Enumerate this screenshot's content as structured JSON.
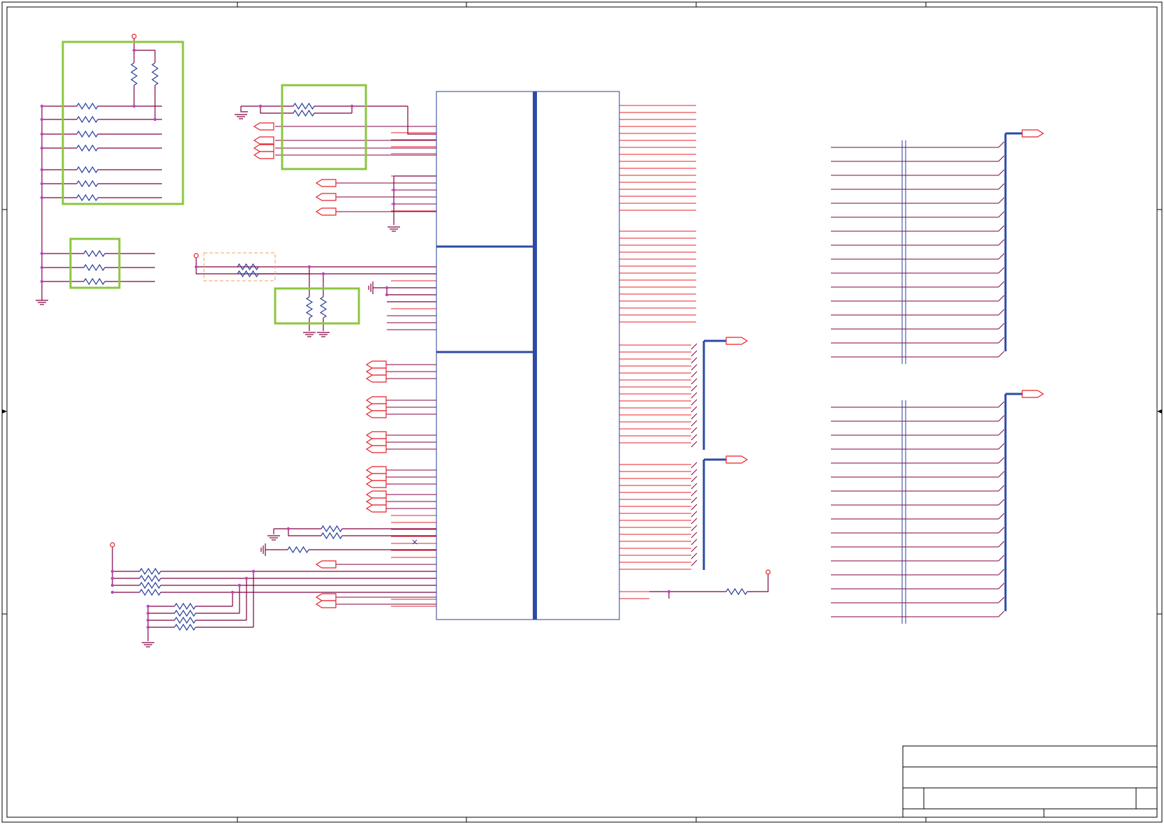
{
  "colors": {
    "wire": "#800040",
    "pin": "#e8202a",
    "component": "#2a3d9a",
    "bus": "#2e4aa6",
    "junction": "#c040c0",
    "highlight": "#8cc63f",
    "optional": "#f0a060",
    "frame": "#000000"
  },
  "diagram": {
    "title_block": {
      "title": "",
      "sheet": "",
      "rev": ""
    }
  }
}
